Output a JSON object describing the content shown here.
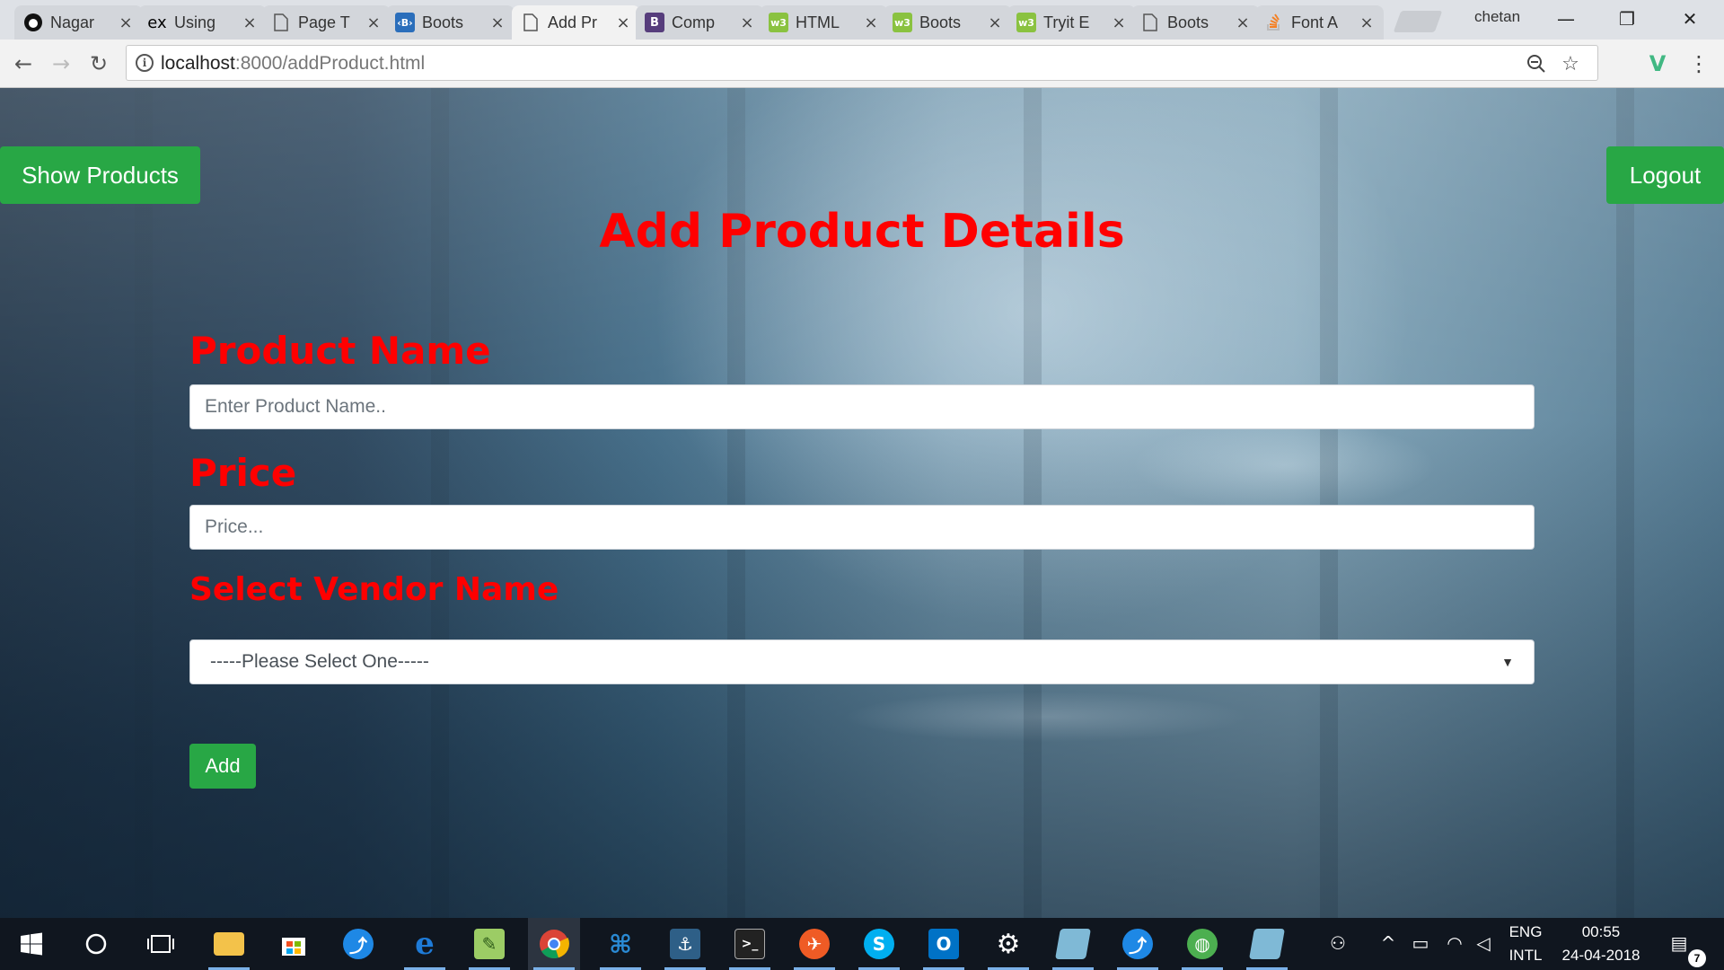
{
  "browser": {
    "tabs": [
      {
        "title": "Nagar",
        "icon": "github-icon",
        "color": "#000000"
      },
      {
        "title": "Using",
        "icon": "ex-icon",
        "color": "#000000"
      },
      {
        "title": "Page T",
        "icon": "page-icon",
        "color": "#555555"
      },
      {
        "title": "Boots",
        "icon": "bootstrap-blue-icon",
        "color": "#2a6ebb"
      },
      {
        "title": "Add Pr",
        "icon": "page-icon",
        "color": "#555555",
        "active": true
      },
      {
        "title": "Comp",
        "icon": "bootstrap-icon",
        "color": "#563d7c"
      },
      {
        "title": "HTML",
        "icon": "w3schools-icon",
        "color": "#8ac240"
      },
      {
        "title": "Boots",
        "icon": "w3schools-icon",
        "color": "#8ac240"
      },
      {
        "title": "Tryit E",
        "icon": "w3schools-icon",
        "color": "#8ac240"
      },
      {
        "title": "Boots",
        "icon": "page-icon",
        "color": "#555555"
      },
      {
        "title": "Font A",
        "icon": "stackoverflow-icon",
        "color": "#f48024"
      }
    ],
    "profile_name": "chetan",
    "url_host": "localhost",
    "url_path": ":8000/addProduct.html"
  },
  "page": {
    "show_products_label": "Show Products",
    "logout_label": "Logout",
    "heading": "Add Product Details",
    "product_name_label": "Product Name",
    "product_name_placeholder": "Enter Product Name..",
    "price_label": "Price",
    "price_placeholder": "Price...",
    "vendor_label": "Select Vendor Name",
    "vendor_selected": "-----Please Select One-----",
    "add_label": "Add"
  },
  "taskbar": {
    "language_top": "ENG",
    "language_bottom": "INTL",
    "time": "00:55",
    "date": "24-04-2018",
    "notification_count": "7"
  },
  "colors": {
    "accent_green": "#28a745",
    "label_red": "#ff0000"
  }
}
